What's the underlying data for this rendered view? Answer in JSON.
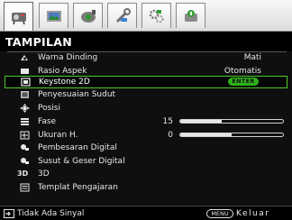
{
  "tabs": [
    {
      "id": "display",
      "icon": "display-icon",
      "active": true
    },
    {
      "id": "picture",
      "icon": "picture-icon",
      "active": false
    },
    {
      "id": "source",
      "icon": "source-icon",
      "active": false
    },
    {
      "id": "system-setup",
      "icon": "system-setup-icon",
      "active": false
    },
    {
      "id": "advanced",
      "icon": "advanced-icon",
      "active": false
    },
    {
      "id": "information",
      "icon": "information-icon",
      "active": false
    }
  ],
  "header": {
    "title": "TAMPILAN"
  },
  "menu": {
    "items": [
      {
        "label": "Warna Dinding",
        "value": "Mati",
        "icon": "wall-color-icon"
      },
      {
        "label": "Rasio Aspek",
        "value": "Otomatis",
        "icon": "aspect-ratio-icon"
      },
      {
        "label": "Keystone 2D",
        "badge": "ENTER",
        "icon": "keystone-icon",
        "selected": true
      },
      {
        "label": "Penyesuaian Sudut",
        "icon": "corner-fit-icon"
      },
      {
        "label": "Posisi",
        "icon": "position-icon"
      },
      {
        "label": "Fase",
        "value": "15",
        "slider": 0.4,
        "icon": "phase-icon"
      },
      {
        "label": "Ukuran H.",
        "value": "0",
        "slider": 0.5,
        "icon": "h-size-icon"
      },
      {
        "label": "Pembesaran Digital",
        "icon": "digital-zoom-icon"
      },
      {
        "label": "Susut & Geser Digital",
        "icon": "digital-shrink-shift-icon"
      },
      {
        "label": "3D",
        "icon": "3d-icon",
        "icon_text": "3D"
      },
      {
        "label": "Templat Pengajaran",
        "icon": "teaching-template-icon"
      }
    ]
  },
  "footer": {
    "source_text": "Tidak Ada Sinyal",
    "menu_button": "MENU",
    "exit_text": "Keluar"
  },
  "colors": {
    "background": "#0f0f0f",
    "highlight": "#4fc72f",
    "enter_badge": "#2fb11a",
    "text": "#e8e8e8"
  }
}
